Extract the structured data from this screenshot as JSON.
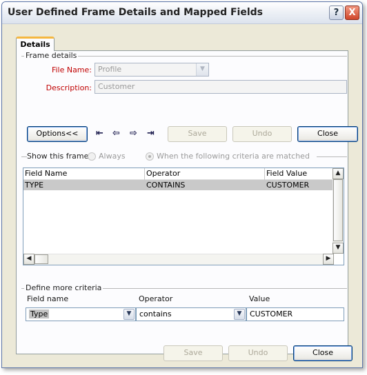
{
  "window": {
    "title": "User Defined Frame Details and Mapped Fields",
    "help_label": "?",
    "close_label": "X"
  },
  "tabs": [
    {
      "label": "Details",
      "active": true
    }
  ],
  "frame_details": {
    "group_label": "Frame details",
    "file_name_label": "File Name:",
    "file_name_value": "Profile",
    "description_label": "Description:",
    "description_value": "Customer"
  },
  "toolbar": {
    "options_label": "Options<<",
    "nav_icons": [
      "first-record-icon",
      "previous-record-icon",
      "next-record-icon",
      "last-record-icon"
    ],
    "nav_glyphs": [
      "⇤",
      "⇦",
      "⇨",
      "⇥"
    ],
    "save_label": "Save",
    "undo_label": "Undo",
    "close_label": "Close"
  },
  "show_frame": {
    "label": "Show this frame:",
    "option_always": "Always",
    "option_criteria": "When the following criteria are matched",
    "selected": "criteria"
  },
  "criteria_grid": {
    "columns": [
      "Field Name",
      "Operator",
      "Field Value"
    ],
    "rows": [
      [
        "TYPE",
        "CONTAINS",
        "CUSTOMER"
      ]
    ],
    "scroll_glyphs": {
      "up": "▲",
      "down": "▼",
      "left": "◀",
      "right": "▶"
    }
  },
  "define_criteria": {
    "group_label": "Define more criteria",
    "field_name_label": "Field name",
    "operator_label": "Operator",
    "value_label": "Value",
    "field_name_value": "Type",
    "operator_value": "contains",
    "value_value": "CUSTOMER",
    "dropdown_glyph": "▼"
  },
  "footer": {
    "save_label": "Save",
    "undo_label": "Undo",
    "close_label": "Close"
  }
}
